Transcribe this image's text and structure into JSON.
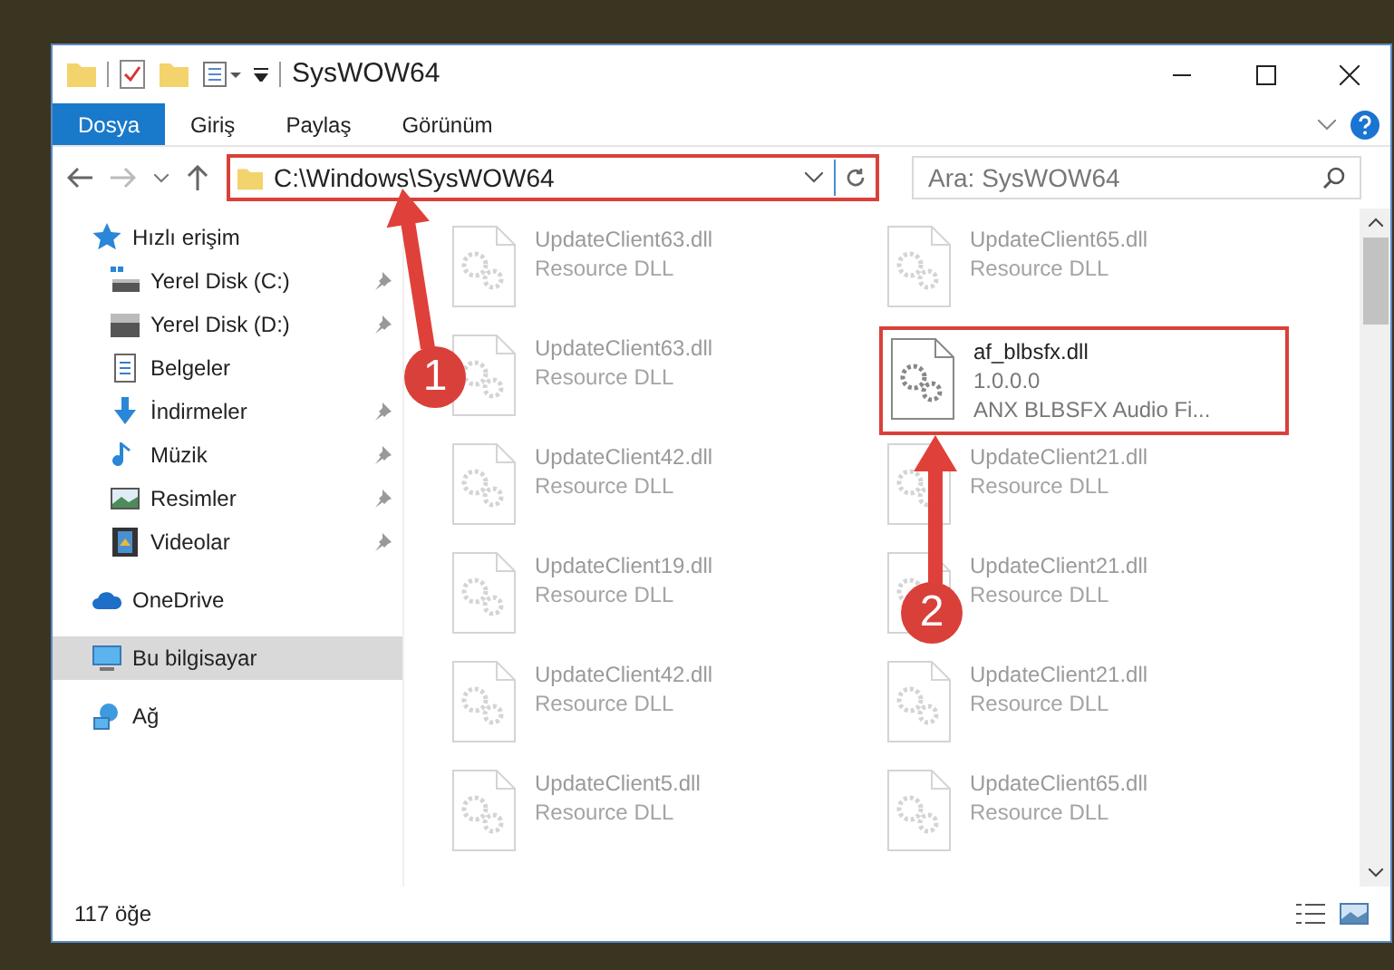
{
  "window": {
    "title": "SysWOW64"
  },
  "ribbon_tabs": [
    {
      "label": "Dosya",
      "selected": true
    },
    {
      "label": "Giriş",
      "selected": false
    },
    {
      "label": "Paylaş",
      "selected": false
    },
    {
      "label": "Görünüm",
      "selected": false
    }
  ],
  "address": {
    "path": "C:\\Windows\\SysWOW64",
    "highlighted": true
  },
  "search": {
    "placeholder": "Ara: SysWOW64"
  },
  "sidebar": {
    "items": [
      {
        "label": "Hızlı erişim",
        "kind": "star",
        "selected": false,
        "children": [
          {
            "label": "Yerel Disk (C:)",
            "kind": "disk-c",
            "pinned": true,
            "selected": false
          },
          {
            "label": "Yerel Disk (D:)",
            "kind": "disk",
            "pinned": true,
            "selected": false
          },
          {
            "label": "Belgeler",
            "kind": "doc",
            "selected": false
          },
          {
            "label": "İndirmeler",
            "kind": "download",
            "pinned": true,
            "selected": false
          },
          {
            "label": "Müzik",
            "kind": "music",
            "pinned": true,
            "selected": false
          },
          {
            "label": "Resimler",
            "kind": "picture",
            "pinned": true,
            "selected": false
          },
          {
            "label": "Videolar",
            "kind": "video",
            "pinned": true,
            "selected": false
          }
        ]
      },
      {
        "label": "OneDrive",
        "kind": "cloud",
        "selected": false
      },
      {
        "label": "Bu bilgisayar",
        "kind": "pc",
        "selected": true
      },
      {
        "label": "Ağ",
        "kind": "network",
        "selected": false
      }
    ]
  },
  "files": [
    {
      "name": "UpdateClient63.dll",
      "details": [
        "Resource DLL"
      ],
      "faded": true,
      "highlighted": false
    },
    {
      "name": "UpdateClient65.dll",
      "details": [
        "Resource DLL"
      ],
      "faded": true,
      "highlighted": false
    },
    {
      "name": "UpdateClient63.dll",
      "details": [
        "Resource DLL"
      ],
      "faded": true,
      "highlighted": false
    },
    {
      "name": "af_blbsfx.dll",
      "details": [
        "1.0.0.0",
        "ANX BLBSFX Audio Fi..."
      ],
      "faded": false,
      "highlighted": true
    },
    {
      "name": "UpdateClient42.dll",
      "details": [
        "Resource DLL"
      ],
      "faded": true,
      "highlighted": false
    },
    {
      "name": "UpdateClient21.dll",
      "details": [
        "Resource DLL"
      ],
      "faded": true,
      "highlighted": false
    },
    {
      "name": "UpdateClient19.dll",
      "details": [
        "Resource DLL"
      ],
      "faded": true,
      "highlighted": false
    },
    {
      "name": "UpdateClient21.dll",
      "details": [
        "Resource DLL"
      ],
      "faded": true,
      "highlighted": false
    },
    {
      "name": "UpdateClient42.dll",
      "details": [
        "Resource DLL"
      ],
      "faded": true,
      "highlighted": false
    },
    {
      "name": "UpdateClient21.dll",
      "details": [
        "Resource DLL"
      ],
      "faded": true,
      "highlighted": false
    },
    {
      "name": "UpdateClient5.dll",
      "details": [
        "Resource DLL"
      ],
      "faded": true,
      "highlighted": false
    },
    {
      "name": "UpdateClient65.dll",
      "details": [
        "Resource DLL"
      ],
      "faded": true,
      "highlighted": false
    }
  ],
  "status_bar": {
    "count": "117 öğe"
  },
  "annotations": [
    {
      "label": "1"
    },
    {
      "label": "2"
    }
  ]
}
